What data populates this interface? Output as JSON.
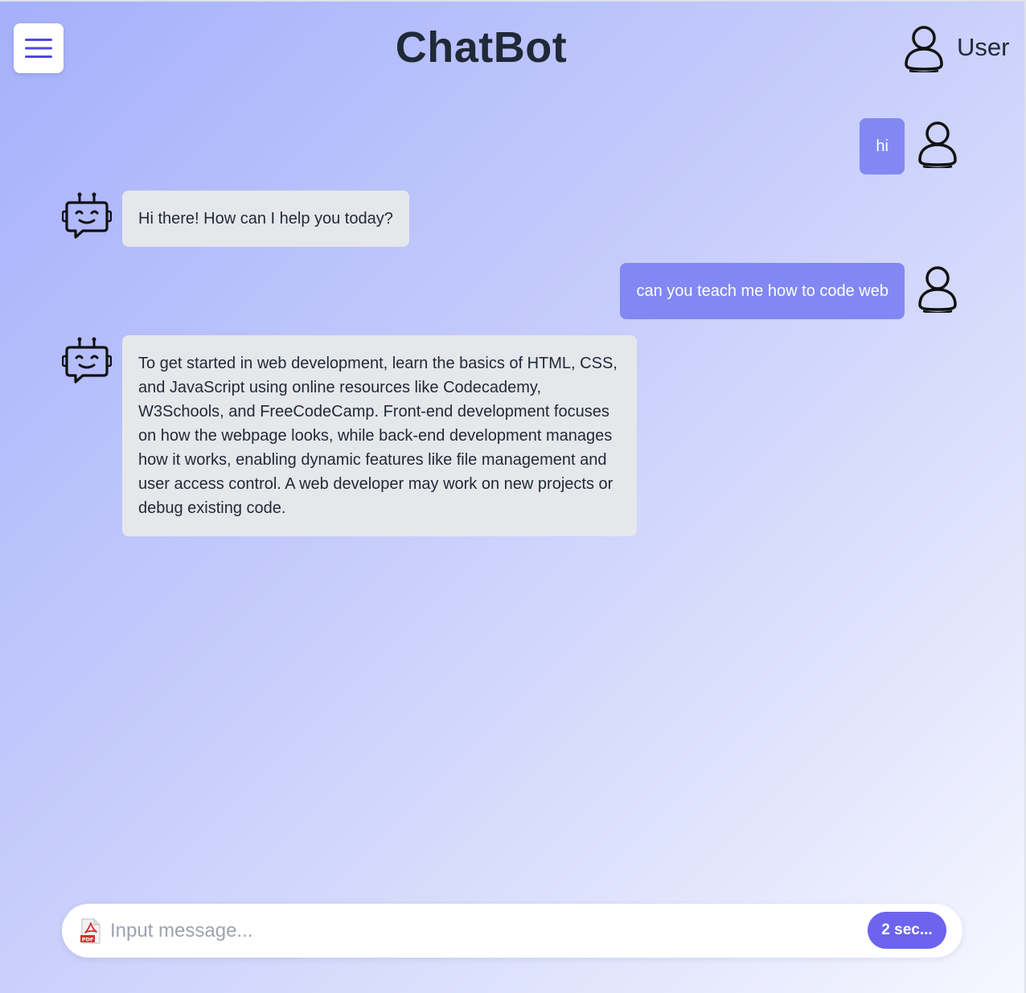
{
  "header": {
    "title": "ChatBot",
    "user_label": "User",
    "menu_icon": "hamburger-menu-icon",
    "user_icon": "user-avatar-icon"
  },
  "messages": [
    {
      "role": "user",
      "text": "hi"
    },
    {
      "role": "bot",
      "text": "Hi there! How can I help you today?"
    },
    {
      "role": "user",
      "text": "can you teach me how to code web"
    },
    {
      "role": "bot",
      "text": "To get started in web development, learn the basics of HTML, CSS, and JavaScript using online resources like Codecademy, W3Schools, and FreeCodeCamp. Front-end development focuses on how the webpage looks, while back-end development manages how it works, enabling dynamic features like file management and user access control. A web developer may work on new projects or debug existing code."
    }
  ],
  "composer": {
    "placeholder": "Input message...",
    "value": "",
    "send_label": "2 sec...",
    "attach_icon": "pdf-file-icon",
    "pdf_badge": "PDF"
  },
  "colors": {
    "accent": "#6c63ef",
    "user_bubble": "#8188f3",
    "bot_bubble": "#e5e7eb",
    "menu_icon": "#4f46e5",
    "title_text": "#1f2937"
  }
}
